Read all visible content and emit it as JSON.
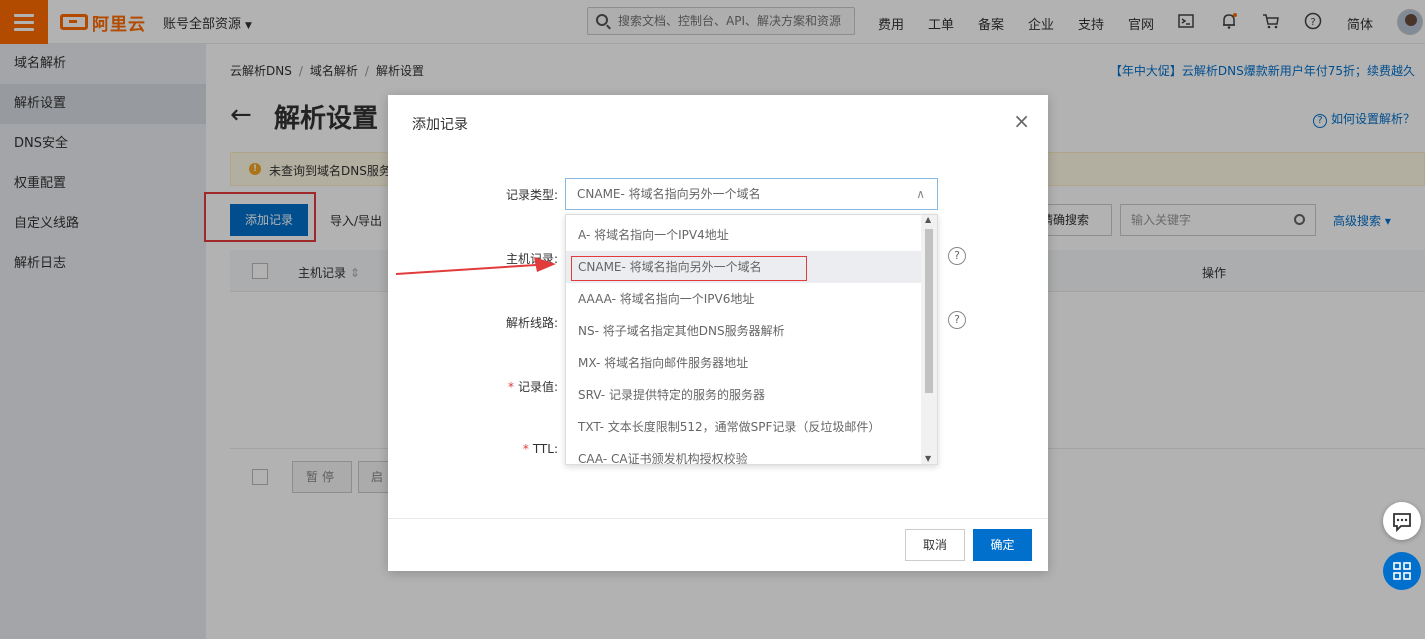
{
  "topbar": {
    "brand": "阿里云",
    "account": "账号全部资源",
    "search_placeholder": "搜索文档、控制台、API、解决方案和资源",
    "nav": [
      "费用",
      "工单",
      "备案",
      "企业",
      "支持",
      "官网"
    ],
    "language": "简体",
    "icons": [
      "terminal-icon",
      "bell-icon",
      "cart-icon",
      "help-circle-icon"
    ]
  },
  "sidebar": {
    "items": [
      {
        "label": "域名解析",
        "active": false
      },
      {
        "label": "解析设置",
        "active": true
      },
      {
        "label": "DNS安全",
        "active": false
      },
      {
        "label": "权重配置",
        "active": false
      },
      {
        "label": "自定义线路",
        "active": false
      },
      {
        "label": "解析日志",
        "active": false
      }
    ]
  },
  "main": {
    "breadcrumb": [
      "云解析DNS",
      "域名解析",
      "解析设置"
    ],
    "promo": "【年中大促】云解析DNS爆款新用户年付75折；续费越久",
    "title": "解析设置",
    "help_link": "如何设置解析？",
    "warning": "未查询到域名DNS服务",
    "add_record": "添加记录",
    "import_export": "导入/导出",
    "exact_search": "精确搜索",
    "keyword_placeholder": "输入关键字",
    "advanced_search": "高级搜索",
    "col_host": "主机记录",
    "col_op": "操作",
    "pause": "暂停",
    "enable": "启"
  },
  "modal": {
    "title": "添加记录",
    "labels": {
      "record_type": "记录类型:",
      "host": "主机记录:",
      "line": "解析线路:",
      "value": "记录值:",
      "ttl": "TTL:"
    },
    "selected_type": "CNAME- 将域名指向另外一个域名",
    "options": [
      "A- 将域名指向一个IPV4地址",
      "CNAME- 将域名指向另外一个域名",
      "AAAA- 将域名指向一个IPV6地址",
      "NS- 将子域名指定其他DNS服务器解析",
      "MX- 将域名指向邮件服务器地址",
      "SRV- 记录提供特定的服务的服务器",
      "TXT- 文本长度限制512，通常做SPF记录（反垃圾邮件）",
      "CAA- CA证书颁发机构授权校验"
    ],
    "cancel": "取消",
    "confirm": "确定"
  },
  "colors": {
    "brand_orange": "#ff6a00",
    "primary_blue": "#0070cc",
    "highlight_red": "#e23b3b"
  }
}
